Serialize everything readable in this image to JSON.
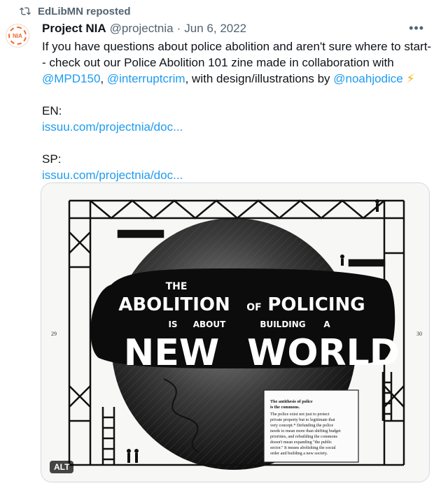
{
  "repost": {
    "icon": "repost-icon",
    "text": "EdLibMN reposted"
  },
  "post": {
    "avatar_label": "NIA",
    "name": "Project NIA",
    "handle": "@projectnia",
    "separator": "·",
    "date": "Jun 6, 2022",
    "more_icon": "more-icon",
    "line1": "If you have questions about police abolition and aren't sure where to start-",
    "line2": "- check out our Police Abolition 101 zine made in collaboration with",
    "mention1": "@MPD150",
    "comma1": ", ",
    "mention2": "@interruptcrim",
    "mid": ", with design/illustrations by ",
    "mention3": "@noahjodice",
    "bolt": "⚡",
    "en_label": "EN:",
    "en_link": "issuu.com/projectnia/doc...",
    "sp_label": "SP:",
    "sp_link": "issuu.com/projectnia/doc..."
  },
  "media": {
    "alt_badge": "ALT",
    "title_the": "THE",
    "title_abolition": "ABOLITION",
    "title_of": "OF",
    "title_policing": "POLICING",
    "title_is": "IS",
    "title_about": "ABOUT",
    "title_building": "BUILDING",
    "title_a": "A",
    "title_new": "NEW",
    "title_world": "WORLD",
    "page_left": "29",
    "page_right": "30",
    "note_title_1": "The antithesis of police",
    "note_title_2": "is the commons.",
    "note_body_1": "The police exist not just to protect",
    "note_body_2": "private property but to legitimate that",
    "note_body_3": "very concept.* Defunding the police",
    "note_body_4": "needs to mean more than shifting budget",
    "note_body_5": "priorities, and rebuilding the commons",
    "note_body_6": "doesn't mean expanding \"the public",
    "note_body_7": "sector.\" It means abolishing the social",
    "note_body_8": "order and building a new society."
  }
}
